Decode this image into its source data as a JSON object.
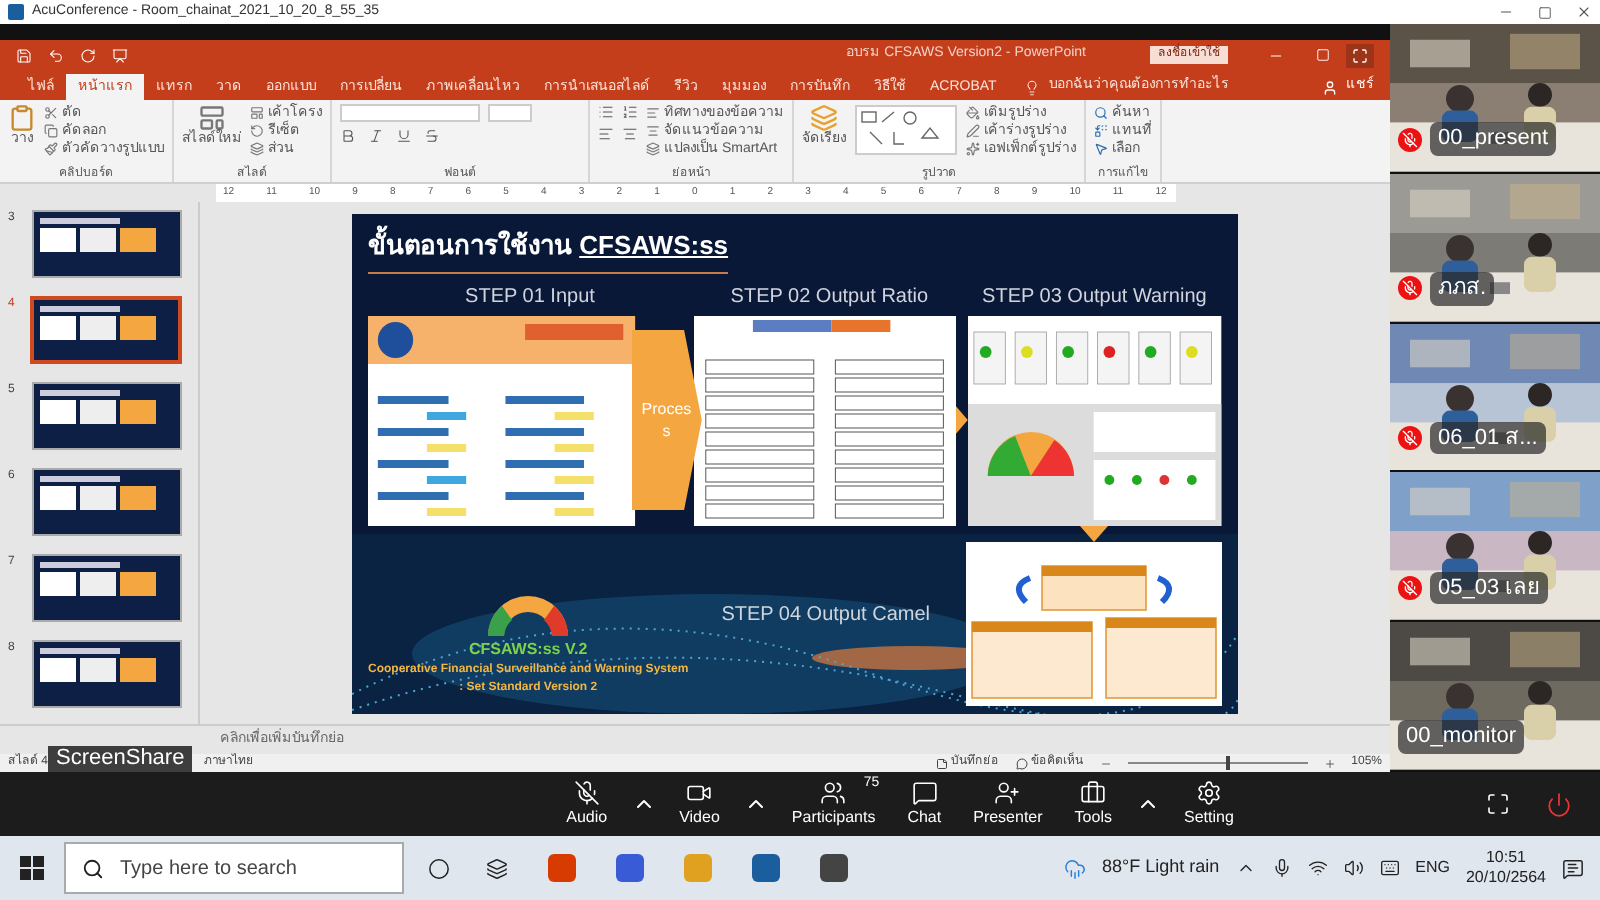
{
  "app": {
    "title": "AcuConference - Room_chainat_2021_10_20_8_55_35"
  },
  "ppt": {
    "title": "อบรม CFSAWS Version2  -  PowerPoint",
    "signin": "ลงชื่อเข้าใช้",
    "share": "แชร์",
    "tell_me": "บอกฉันว่าคุณต้องการทำอะไร",
    "tabs": [
      {
        "label": "ไฟล์",
        "selected": false
      },
      {
        "label": "หน้าแรก",
        "selected": true
      },
      {
        "label": "แทรก",
        "selected": false
      },
      {
        "label": "วาด",
        "selected": false
      },
      {
        "label": "ออกแบบ",
        "selected": false
      },
      {
        "label": "การเปลี่ยน",
        "selected": false
      },
      {
        "label": "ภาพเคลื่อนไหว",
        "selected": false
      },
      {
        "label": "การนำเสนอสไลด์",
        "selected": false
      },
      {
        "label": "รีวิว",
        "selected": false
      },
      {
        "label": "มุมมอง",
        "selected": false
      },
      {
        "label": "การบันทึก",
        "selected": false
      },
      {
        "label": "วิธีใช้",
        "selected": false
      },
      {
        "label": "ACROBAT",
        "selected": false
      }
    ],
    "ribbon_groups": [
      {
        "kind": "clipboard",
        "label": "คลิปบอร์ด",
        "big": "วาง",
        "commands": [
          "ตัด",
          "คัดลอก",
          "ตัวคัดวางรูปแบบ"
        ]
      },
      {
        "kind": "slides",
        "label": "สไลด์",
        "big": "สไลด์ใหม่",
        "commands": [
          "เค้าโครง",
          "รีเซ็ต",
          "ส่วน"
        ]
      },
      {
        "kind": "font",
        "label": "ฟอนต์"
      },
      {
        "kind": "paragraph",
        "label": "ย่อหน้า",
        "commands": [
          "ทิศทางของข้อความ",
          "จัดแนวข้อความ",
          "แปลงเป็น SmartArt"
        ]
      },
      {
        "kind": "drawing",
        "label": "รูปวาด",
        "big": "จัดเรียง",
        "commands": [
          "เติมรูปร่าง",
          "เค้าร่างรูปร่าง",
          "เอฟเฟ็กต์รูปร่าง"
        ]
      },
      {
        "kind": "editing",
        "label": "การแก้ไข",
        "commands": [
          "ค้นหา",
          "แทนที่",
          "เลือก"
        ]
      }
    ],
    "ruler": [
      "12",
      "11",
      "10",
      "9",
      "8",
      "7",
      "6",
      "5",
      "4",
      "3",
      "2",
      "1",
      "0",
      "1",
      "2",
      "3",
      "4",
      "5",
      "6",
      "7",
      "8",
      "9",
      "10",
      "11",
      "12"
    ],
    "slides": [
      {
        "number": "3",
        "selected": false
      },
      {
        "number": "4",
        "selected": true
      },
      {
        "number": "5",
        "selected": false
      },
      {
        "number": "6",
        "selected": false
      },
      {
        "number": "7",
        "selected": false
      },
      {
        "number": "8",
        "selected": false
      }
    ],
    "slide": {
      "title": "ขั้นตอนการใช้งาน ",
      "title_link": "CFSAWS:ss",
      "steps": [
        "STEP 01 Input",
        "STEP 02 Output Ratio",
        "STEP 03 Output Warning",
        "STEP 04 Output Camel"
      ],
      "process": [
        "Proces",
        "s"
      ],
      "logo": "CFSAWS:ss V.2",
      "caption": [
        "Cooperative Financial Surveillance and Warning System",
        ": Set Standard Version 2"
      ]
    },
    "notes": {
      "placeholder": "คลิกเพื่อเพิ่มบันทึกย่อ"
    },
    "status": {
      "slide": "สไลด์ 4",
      "language": "ภาษาไทย",
      "notes": "บันทึกย่อ",
      "comments": "ข้อคิดเห็น",
      "zoom": "105%",
      "zoom_slider": {
        "level": 0.55
      }
    }
  },
  "screenshare": "ScreenShare",
  "participants": [
    {
      "name": "00_present",
      "muted": true
    },
    {
      "name": "ภภส.",
      "muted": true
    },
    {
      "name": "06_01 ส...",
      "muted": true
    },
    {
      "name": "05_03 เลย",
      "muted": true
    },
    {
      "name": "00_monitor",
      "muted": false
    }
  ],
  "toolbar": [
    {
      "kind": "audio",
      "label": "Audio",
      "caret": true
    },
    {
      "kind": "video",
      "label": "Video",
      "caret": true
    },
    {
      "kind": "participants",
      "label": "Participants",
      "badge": "75",
      "caret": false
    },
    {
      "kind": "chat",
      "label": "Chat",
      "caret": false
    },
    {
      "kind": "presenter",
      "label": "Presenter",
      "caret": false
    },
    {
      "kind": "tools",
      "label": "Tools",
      "caret": true
    },
    {
      "kind": "setting",
      "label": "Setting",
      "caret": false
    }
  ],
  "taskbar": {
    "search": "Type here to search",
    "weather": "88°F  Light rain",
    "lang": "ENG",
    "time": "10:51",
    "date": "20/10/2564"
  }
}
